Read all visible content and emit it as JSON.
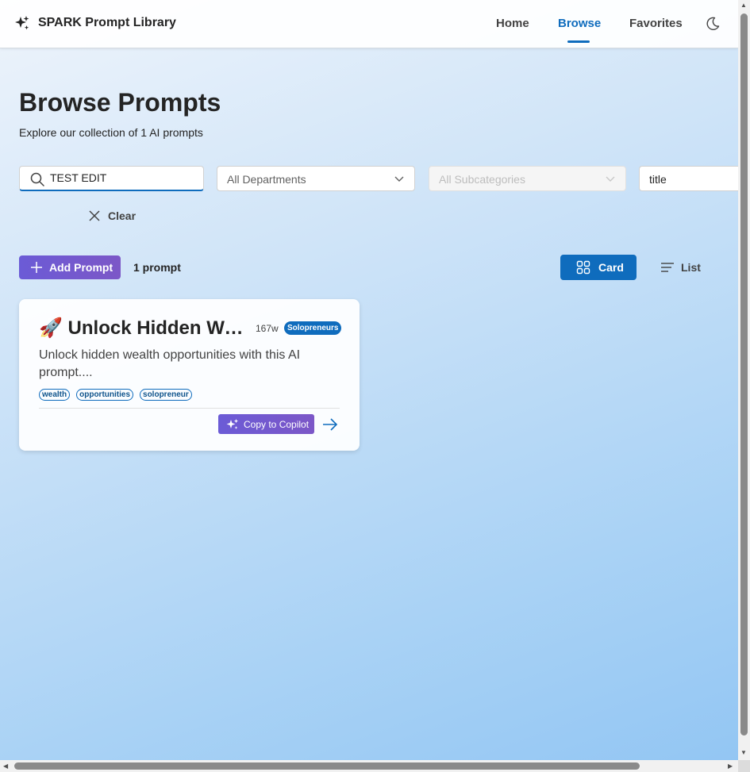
{
  "header": {
    "brand_title": "SPARK Prompt Library",
    "nav": [
      {
        "label": "Home",
        "active": false
      },
      {
        "label": "Browse",
        "active": true
      },
      {
        "label": "Favorites",
        "active": false
      }
    ],
    "theme_icon": "moon-icon"
  },
  "page": {
    "title": "Browse Prompts",
    "subtitle": "Explore our collection of 1 AI prompts"
  },
  "filters": {
    "search_value": "TEST EDIT",
    "department": "All Departments",
    "subcategory": "All Subcategories",
    "sort": "title",
    "clear_label": "Clear"
  },
  "toolbar": {
    "add_label": "Add Prompt",
    "count_label": "1 prompt",
    "card_view_label": "Card",
    "list_view_label": "List"
  },
  "cards": [
    {
      "title": "🚀 Unlock Hidden Wealth Opportunities",
      "words": "167w",
      "badge": "Solopreneurs",
      "description": "Unlock hidden wealth opportunities with this AI prompt....",
      "tags": [
        "wealth",
        "opportunities",
        "solopreneur"
      ],
      "copy_label": "Copy to Copilot"
    }
  ],
  "colors": {
    "accent": "#0f6cbd",
    "purple": "#6b5bd6"
  }
}
